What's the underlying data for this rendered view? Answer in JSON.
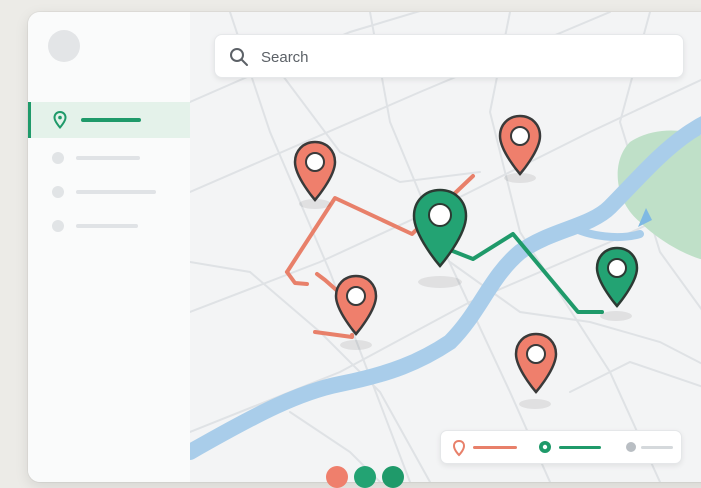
{
  "search": {
    "placeholder": "Search",
    "icon": "search-icon"
  },
  "colors": {
    "accent_green": "#1f9a6a",
    "route_red": "#e8806a",
    "marker_red": "#ef7f6c",
    "marker_green": "#23a373",
    "river": "#a9cdea",
    "park": "#bfe0c8"
  },
  "sidebar": {
    "items": [
      {
        "icon": "map-pin-icon",
        "active": true
      },
      {
        "icon": "dot-icon",
        "active": false
      },
      {
        "icon": "dot-icon",
        "active": false
      },
      {
        "icon": "dot-icon",
        "active": false
      }
    ]
  },
  "map": {
    "markers": [
      {
        "type": "red",
        "icon": "map-pin-icon"
      },
      {
        "type": "red",
        "icon": "map-pin-icon"
      },
      {
        "type": "green",
        "icon": "map-pin-icon"
      },
      {
        "type": "red",
        "icon": "map-pin-icon"
      },
      {
        "type": "green",
        "icon": "map-pin-icon"
      },
      {
        "type": "red",
        "icon": "map-pin-icon"
      }
    ],
    "routes": [
      "red",
      "green"
    ]
  },
  "legend": {
    "items": [
      {
        "icon": "red-pin-icon",
        "color": "#e8806a"
      },
      {
        "icon": "green-pin-icon",
        "color": "#1f9a6a"
      },
      {
        "icon": "grey-dot-icon",
        "color": "#b9bec3"
      }
    ]
  }
}
